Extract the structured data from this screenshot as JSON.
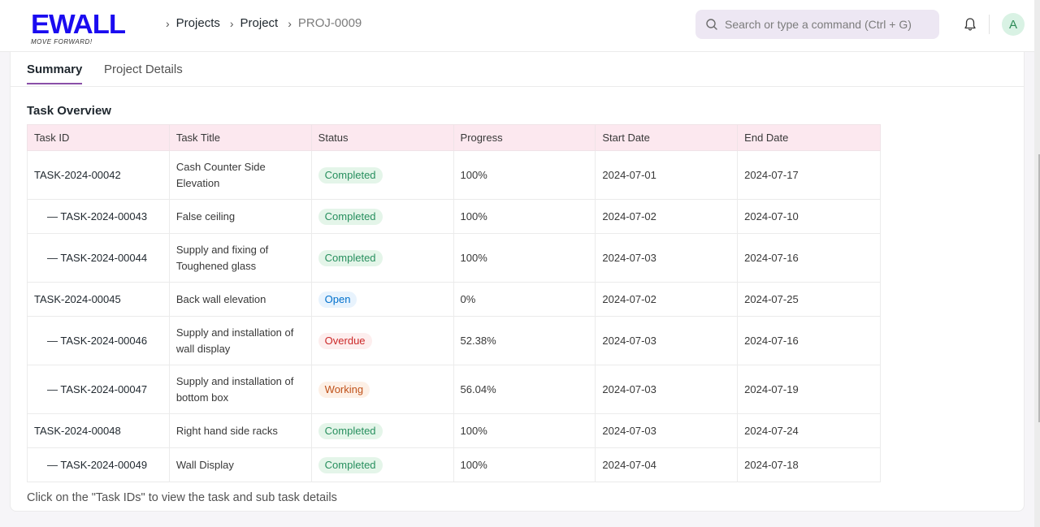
{
  "brand": {
    "name": "EWALL",
    "tagline": "MOVE FORWARD!",
    "color": "#1a0bf0"
  },
  "breadcrumb": [
    {
      "label": "Projects",
      "current": false
    },
    {
      "label": "Project",
      "current": false
    },
    {
      "label": "PROJ-0009",
      "current": true
    }
  ],
  "search": {
    "placeholder": "Search or type a command (Ctrl + G)",
    "icon": "search-icon"
  },
  "header_icons": {
    "notifications": "bell-icon"
  },
  "user": {
    "avatar_letter": "A"
  },
  "tabs": [
    {
      "label": "Summary",
      "active": true
    },
    {
      "label": "Project Details",
      "active": false
    }
  ],
  "section": {
    "title": "Task Overview"
  },
  "table": {
    "columns": [
      "Task ID",
      "Task Title",
      "Status",
      "Progress",
      "Start Date",
      "End Date"
    ],
    "rows": [
      {
        "id": "TASK-2024-00042",
        "subtask": false,
        "title": "Cash Counter Side Elevation",
        "status": "Completed",
        "progress": "100%",
        "start": "2024-07-01",
        "end": "2024-07-17"
      },
      {
        "id": "— TASK-2024-00043",
        "subtask": true,
        "title": "False ceiling",
        "status": "Completed",
        "progress": "100%",
        "start": "2024-07-02",
        "end": "2024-07-10"
      },
      {
        "id": "— TASK-2024-00044",
        "subtask": true,
        "title": "Supply and fixing of Toughened glass",
        "status": "Completed",
        "progress": "100%",
        "start": "2024-07-03",
        "end": "2024-07-16"
      },
      {
        "id": "TASK-2024-00045",
        "subtask": false,
        "title": "Back wall elevation",
        "status": "Open",
        "progress": "0%",
        "start": "2024-07-02",
        "end": "2024-07-25"
      },
      {
        "id": "— TASK-2024-00046",
        "subtask": true,
        "title": "Supply and installation of wall display",
        "status": "Overdue",
        "progress": "52.38%",
        "start": "2024-07-03",
        "end": "2024-07-16"
      },
      {
        "id": "— TASK-2024-00047",
        "subtask": true,
        "title": "Supply and installation of bottom box",
        "status": "Working",
        "progress": "56.04%",
        "start": "2024-07-03",
        "end": "2024-07-19"
      },
      {
        "id": "TASK-2024-00048",
        "subtask": false,
        "title": "Right hand side racks",
        "status": "Completed",
        "progress": "100%",
        "start": "2024-07-03",
        "end": "2024-07-24"
      },
      {
        "id": "— TASK-2024-00049",
        "subtask": true,
        "title": "Wall Display",
        "status": "Completed",
        "progress": "100%",
        "start": "2024-07-04",
        "end": "2024-07-18"
      }
    ]
  },
  "status_colors": {
    "Completed": "#278f5e",
    "Open": "#0070cc",
    "Overdue": "#cc2929",
    "Working": "#c0521a"
  },
  "footer_note": "Click on the \"Task IDs\" to view the task and sub task details"
}
